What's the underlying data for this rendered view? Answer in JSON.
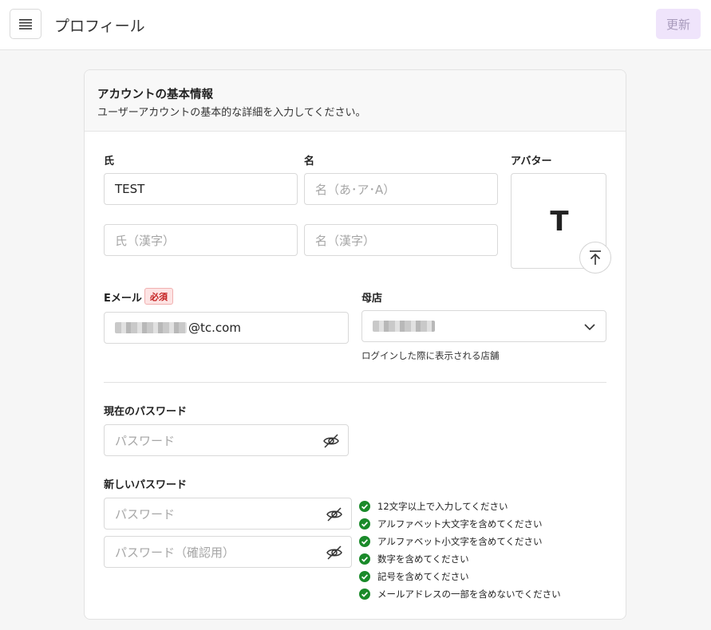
{
  "header": {
    "menu_icon": "hamburger-menu-icon",
    "title": "プロフィール",
    "update_label": "更新"
  },
  "card": {
    "title": "アカウントの基本情報",
    "subtitle": "ユーザーアカウントの基本的な詳細を入力してください。"
  },
  "fields": {
    "last_name": {
      "label": "氏",
      "value": "TEST",
      "placeholder": ""
    },
    "first_name": {
      "label": "名",
      "value": "",
      "placeholder": "名（あ･ア･A）"
    },
    "last_name_kanji": {
      "value": "",
      "placeholder": "氏（漢字）"
    },
    "first_name_kanji": {
      "value": "",
      "placeholder": "名（漢字）"
    },
    "avatar": {
      "label": "アバター",
      "letter": "T",
      "upload_icon": "upload-icon"
    },
    "email": {
      "label": "Eメール",
      "required_badge": "必須",
      "value_visible": "@tc.com"
    },
    "home_store": {
      "label": "母店",
      "hint": "ログインした際に表示される店舗",
      "dropdown_icon": "chevron-down-icon"
    },
    "current_password": {
      "label": "現在のパスワード",
      "placeholder": "パスワード",
      "eye_icon": "eye-off-icon"
    },
    "new_password": {
      "label": "新しいパスワード",
      "placeholder": "パスワード",
      "eye_icon": "eye-off-icon"
    },
    "confirm_password": {
      "placeholder": "パスワード（確認用）",
      "eye_icon": "eye-off-icon"
    }
  },
  "password_rules": [
    "12文字以上で入力してください",
    "アルファベット大文字を含めてください",
    "アルファベット小文字を含めてください",
    "数字を含めてください",
    "記号を含めてください",
    "メールアドレスの一部を含めないでください"
  ],
  "colors": {
    "accent_light": "#efe4fb",
    "required": "#c42020",
    "check": "#1a8a2a"
  }
}
